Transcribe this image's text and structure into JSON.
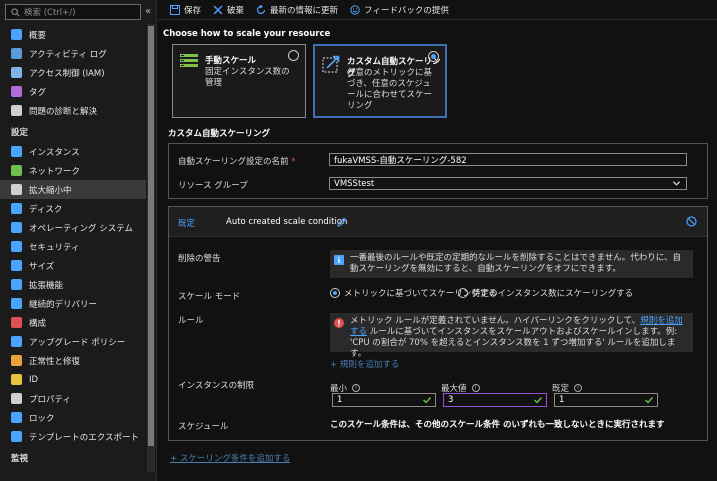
{
  "sidebar": {
    "search_placeholder": "検索 (Ctrl+/)",
    "collapse_glyph": "«",
    "items": [
      {
        "label": "概要",
        "icon": "overview-icon",
        "color": "#4aa3ff"
      },
      {
        "label": "アクティビティ ログ",
        "icon": "activity-log-icon",
        "color": "#5b9bd5"
      },
      {
        "label": "アクセス制御 (IAM)",
        "icon": "iam-icon",
        "color": "#7fb3e6"
      },
      {
        "label": "タグ",
        "icon": "tag-icon",
        "color": "#b36bd9"
      },
      {
        "label": "問題の診断と解決",
        "icon": "wrench-icon",
        "color": "#cfcfcf"
      }
    ],
    "section_settings": "設定",
    "settings_items": [
      {
        "label": "インスタンス",
        "icon": "instances-icon",
        "color": "#4aa3ff",
        "active": false
      },
      {
        "label": "ネットワーク",
        "icon": "network-icon",
        "color": "#6fc04b",
        "active": false
      },
      {
        "label": "拡大縮小中",
        "icon": "scale-icon",
        "color": "#cfcfcf",
        "active": true
      },
      {
        "label": "ディスク",
        "icon": "disk-icon",
        "color": "#4aa3ff",
        "active": false
      },
      {
        "label": "オペレーティング システム",
        "icon": "os-icon",
        "color": "#4aa3ff",
        "active": false
      },
      {
        "label": "セキュリティ",
        "icon": "shield-icon",
        "color": "#4aa3ff",
        "active": false
      },
      {
        "label": "サイズ",
        "icon": "size-icon",
        "color": "#4aa3ff",
        "active": false
      },
      {
        "label": "拡張機能",
        "icon": "extensions-icon",
        "color": "#4aa3ff",
        "active": false
      },
      {
        "label": "継続的デリバリー",
        "icon": "delivery-icon",
        "color": "#4aa3ff",
        "active": false
      },
      {
        "label": "構成",
        "icon": "config-icon",
        "color": "#e05050",
        "active": false
      },
      {
        "label": "アップグレード ポリシー",
        "icon": "upgrade-icon",
        "color": "#4aa3ff",
        "active": false
      },
      {
        "label": "正常性と修復",
        "icon": "health-icon",
        "color": "#e8a33d",
        "active": false
      },
      {
        "label": "ID",
        "icon": "identity-icon",
        "color": "#e8c33d",
        "active": false
      },
      {
        "label": "プロパティ",
        "icon": "properties-icon",
        "color": "#cfcfcf",
        "active": false
      },
      {
        "label": "ロック",
        "icon": "lock-icon",
        "color": "#4aa3ff",
        "active": false
      },
      {
        "label": "テンプレートのエクスポート",
        "icon": "export-icon",
        "color": "#4aa3ff",
        "active": false
      }
    ],
    "section_monitoring": "監視"
  },
  "toolbar": {
    "save": "保存",
    "discard": "破棄",
    "refresh": "最新の情報に更新",
    "feedback": "フィードバックの提供"
  },
  "main": {
    "heading": "Choose how to scale your resource",
    "manual_title": "手動スケール",
    "manual_desc": "固定インスタンス数の管理",
    "custom_title": "カスタム自動スケーリング",
    "custom_desc": "任意のメトリックに基づき、任意のスケジュールに合わせてスケーリング",
    "section_title": "カスタム自動スケーリング",
    "setting_name_label": "自動スケーリング設定の名前",
    "setting_name_required": "*",
    "setting_name_value": "fukaVMSS-自動スケーリング-582",
    "resource_group_label": "リソース グループ",
    "resource_group_value": "VMSStest",
    "condition_default": "既定",
    "condition_name": "Auto created scale condition",
    "delete_warning_label": "削除の警告",
    "delete_warning_text": "一番最後のルールや既定の定期的なルールを削除することはできません。代わりに、自動スケーリングを無効にすると、自動スケーリングをオフにできます。",
    "scale_mode_label": "スケール モード",
    "scale_mode_metric": "メトリックに基づいてスケーリングする",
    "scale_mode_count": "特定のインスタンス数にスケーリングする",
    "rules_label": "ルール",
    "rules_error_before": "メトリック ルールが定義されていません。ハイパーリンクをクリックして、",
    "rules_error_link": "規則を追加する",
    "rules_error_after": " ルールに基づいてインスタンスをスケールアウトおよびスケールインします。例: 'CPU の割合が 70% を超えるとインスタンス数を 1 ずつ増加する' ルールを追加します。",
    "add_rule": "+ 規則を追加する",
    "instance_limits_label": "インスタンスの制限",
    "min_label": "最小",
    "max_label": "最大値",
    "default_label": "既定",
    "min_value": "1",
    "max_value": "3",
    "default_value": "1",
    "schedule_label": "スケジュール",
    "schedule_text": "このスケール条件は、その他のスケール条件 のいずれも一致しないときに実行されます",
    "add_condition": "+ スケーリング条件を追加する"
  }
}
